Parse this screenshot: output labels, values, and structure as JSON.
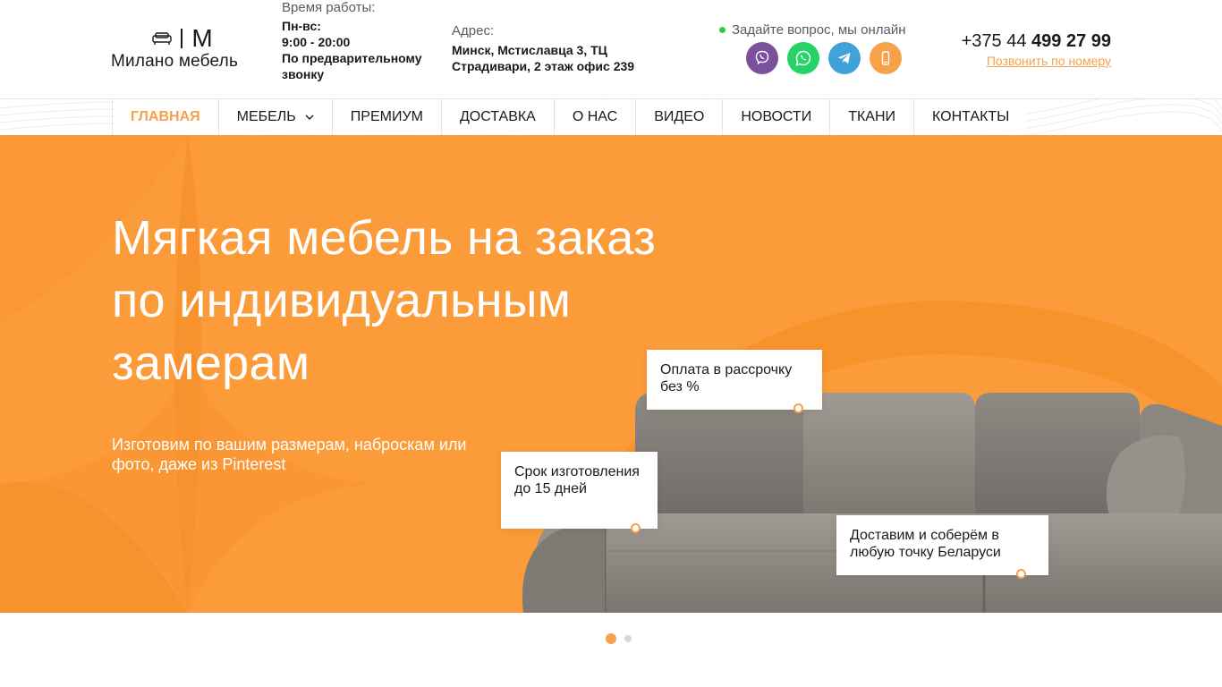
{
  "brand": {
    "mark": "M",
    "name": "Милано мебель"
  },
  "hours": {
    "label": "Время работы:",
    "days": "Пн-вс:",
    "time": "9:00 - 20:00",
    "note": "По предварительному звонку"
  },
  "address": {
    "label": "Адрес:",
    "value": "Минск, Мстиславца 3, ТЦ Страдивари, 2 этаж офис 239"
  },
  "contact": {
    "online_text": "Задайте вопрос, мы онлайн",
    "messengers": [
      {
        "name": "viber",
        "icon": "viber-icon",
        "color": "#7b519d"
      },
      {
        "name": "whatsapp",
        "icon": "whatsapp-icon",
        "color": "#25d366"
      },
      {
        "name": "telegram",
        "icon": "telegram-icon",
        "color": "#3fa3d8"
      },
      {
        "name": "phone",
        "icon": "mobile-phone-icon",
        "color": "#f7a14a"
      }
    ],
    "phone_prefix": "+375 44",
    "phone_number": "499 27 99",
    "callback_link": "Позвонить по номеру"
  },
  "nav": {
    "items": [
      {
        "label": "ГЛАВНАЯ",
        "active": true
      },
      {
        "label": "МЕБЕЛЬ",
        "dropdown": true
      },
      {
        "label": "ПРЕМИУМ"
      },
      {
        "label": "ДОСТАВКА"
      },
      {
        "label": "О НАС"
      },
      {
        "label": "ВИДЕО"
      },
      {
        "label": "НОВОСТИ"
      },
      {
        "label": "ТКАНИ"
      },
      {
        "label": "КОНТАКТЫ"
      }
    ]
  },
  "hero": {
    "title_line1": "Мягкая мебель на заказ",
    "title_line2": "по индивидуальным",
    "title_line3": "замерам",
    "subtitle": "Изготовим по вашим размерам, наброскам или фото, даже из Pinterest",
    "callouts": {
      "payment": "Оплата в рассрочку без %",
      "term": "Срок изготовления до 15 дней",
      "delivery": "Доставим и соберём в любую точку Беларуси"
    }
  },
  "slider": {
    "total": 2,
    "current": 1
  },
  "colors": {
    "accent": "#f7a14a",
    "hero_bg": "#fb9b3a",
    "online_dot": "#2ecc40"
  }
}
